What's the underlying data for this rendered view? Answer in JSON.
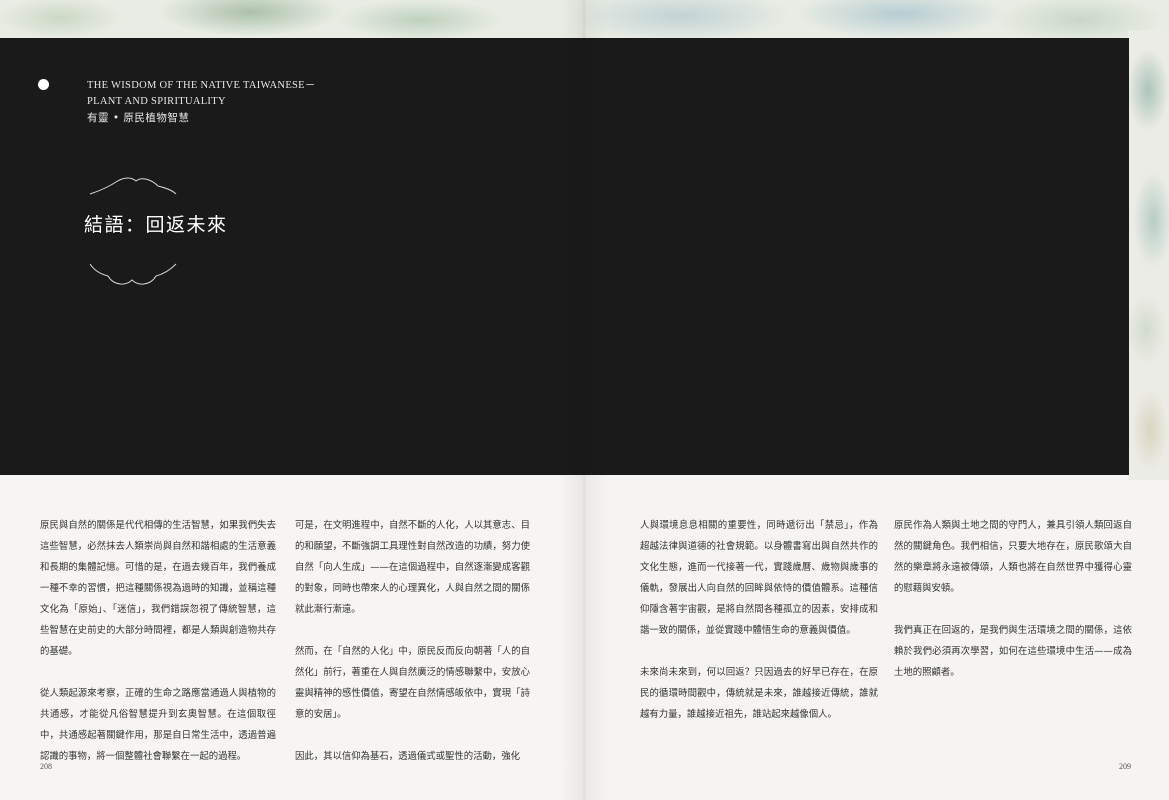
{
  "header": {
    "en_line1": "THE WISDOM OF THE NATIVE TAIWANESE－",
    "en_line2": "PLANT AND SPIRITUALITY",
    "zh": "有靈 • 原民植物智慧"
  },
  "section_title": "結語：回返未來",
  "columns": {
    "c1": [
      "原民與自然的關係是代代相傳的生活智慧，如果我們失去這些智慧，必然抹去人類崇尚與自然和諧相處的生活意義和長期的集體記憶。可惜的是，在過去幾百年，我們養成一種不幸的習慣，把這種關係視為過時的知識，並稱這種文化為「原始」、「迷信」，我們錯誤忽視了傳統智慧，這些智慧在史前史的大部分時間裡，都是人類與創造物共存的基礎。",
      "從人類起源來考察，正確的生命之路應當通過人與植物的共通感，才能從凡俗智慧提升到玄奧智慧。在這個取徑中，共通感起著關鍵作用，那是自日常生活中，透過普遍認識的事物，將一個整體社會聯繫在一起的過程。"
    ],
    "c2": [
      "可是，在文明進程中，自然不斷的人化，人以其意志、目的和願望，不斷強調工具理性對自然改造的功績，努力使自然「向人生成」——在這個過程中，自然逐漸變成客觀的對象，同時也帶來人的心理異化，人與自然之間的關係就此漸行漸遠。",
      "然而，在「自然的人化」中，原民反而反向朝著「人的自然化」前行，著重在人與自然廣泛的情感聯繫中，安放心靈與精神的感性價值，寄望在自然情感皈依中，實現「詩意的安居」。",
      "因此，其以信仰為基石，透過儀式或聖性的活動，強化"
    ],
    "c3": [
      "人與環境息息相關的重要性，同時遞衍出「禁忌」，作為超越法律與道德的社會規範。以身體書寫出與自然共作的文化生態，進而一代接著一代，實踐歲曆、歲物與歲事的儀軌，發展出人向自然的回眸與依恃的價值體系。這種信仰隱含著宇宙觀，是將自然間各種孤立的因素，安排成和諧一致的關係，並從實踐中體悟生命的意義與價值。",
      "未來尚未來到，何以回返？只因過去的好早已存在，在原民的循環時間觀中，傳統就是未來，誰越接近傳統，誰就越有力量，誰越接近祖先，誰站起來越像個人。"
    ],
    "c4": [
      "原民作為人類與土地之間的守門人，兼具引領人類回返自然的關鍵角色。我們相信，只要大地存在，原民歌頌大自然的樂章將永遠被傳頌，人類也將在自然世界中獲得心靈的慰藉與安頓。",
      "我們真正在回返的，是我們與生活環境之間的關係，這依賴於我們必須再次學習，如何在這些環境中生活——成為土地的照顧者。"
    ]
  },
  "folios": {
    "left": "208",
    "right": "209"
  }
}
